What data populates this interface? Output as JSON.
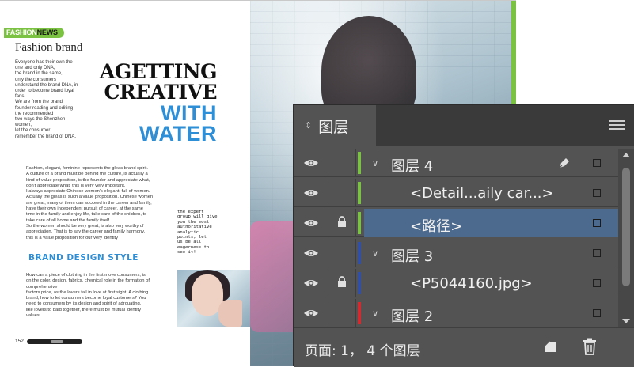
{
  "document": {
    "logo": {
      "fashion": "FASHION",
      "news": "NEWS"
    },
    "brand_title": "Fashion brand",
    "intro_lines": [
      "Everyone has their own the",
      "one and only DNA,",
      " the brand in the same,",
      "only the consumers",
      "understand the brand DNA, in",
      "order to become brand loyal",
      "fans.",
      "We are from the brand",
      "founder reading and editing",
      "the recommended",
      "two ways the Shenzhen",
      "women,",
      " let the consumer",
      "remember the brand of DNA."
    ],
    "headline": {
      "line1": "AGETTING",
      "line2": "CREATIVE",
      "line3": "WITH",
      "line4": "WATER"
    },
    "body1_lines": [
      "Fashion, elegant, feminine represents the gleas brand spirit.",
      "A culture of a brand must be behind the culture, is actually a",
      "kind of value proposition, is the founder and appreciate what,",
      "don't appreciate what, this is very very important.",
      " I always appreciate Chinese women's elegant, full of women.",
      "Actually the gleas is such a value proposition. Chinese women",
      "are great, many of them can succeed in the career and family,",
      "have their own independent pursuit of career, at the same",
      "time in the family and enjoy life, take care of the children, to",
      "take care of all home and the family itself.",
      "So the women should be very great, is also very worthy of",
      "appreciation. That is to say the career and family harmony,",
      "this is a value proposition for our very identity"
    ],
    "side_quote_lines": [
      "the expert",
      "group will give",
      "you the most",
      "authoritative",
      "analytic",
      "points, let",
      "us be all",
      "eagerness to",
      "see it!"
    ],
    "style_heading": "BRAND DESIGN STYLE",
    "body2_lines": [
      "How can a piece of clothing in the first move consumers, is",
      "on the color, design, fabrics, chemical role in the formation of",
      "comprehensive",
      "factors price, as the lovers fall in love at first sight. A clothing",
      "brand, how to let consumers become loyal customers? You",
      "need to consumers by its design and spirit of adrouating,",
      "like lovers to bald together, there must be mutual identity",
      "values."
    ],
    "page_number": "152"
  },
  "layers_panel": {
    "title": "图层",
    "rows": [
      {
        "name": "图层 4",
        "kind": "layer",
        "expanded": true,
        "visible": true,
        "locked": false,
        "color": "#7cc242",
        "editing": true,
        "selected": false
      },
      {
        "name": "<Detail...aily car...>",
        "kind": "object",
        "visible": true,
        "locked": false,
        "color": "#7cc242",
        "selected": false
      },
      {
        "name": "<路径>",
        "kind": "object",
        "visible": true,
        "locked": true,
        "color": "#7cc242",
        "selected": true
      },
      {
        "name": "图层 3",
        "kind": "layer",
        "expanded": true,
        "visible": true,
        "locked": false,
        "color": "#2f4fa8",
        "selected": false
      },
      {
        "name": "<P5044160.jpg>",
        "kind": "object",
        "visible": true,
        "locked": true,
        "color": "#2f4fa8",
        "selected": false
      },
      {
        "name": "图层 2",
        "kind": "layer",
        "expanded": true,
        "visible": true,
        "locked": false,
        "color": "#d9272e",
        "selected": false
      }
    ],
    "footer_status": "页面: 1， 4 个图层",
    "icons": {
      "collapse": "collapse-arrows-icon",
      "menu": "panel-menu-icon",
      "visibility": "eye-icon",
      "lock": "lock-icon",
      "pen": "pen-icon",
      "new_layer": "new-layer-icon",
      "delete": "trash-icon"
    },
    "colors": {
      "panel_bg": "#535353",
      "selection": "#4b6a8e"
    }
  }
}
